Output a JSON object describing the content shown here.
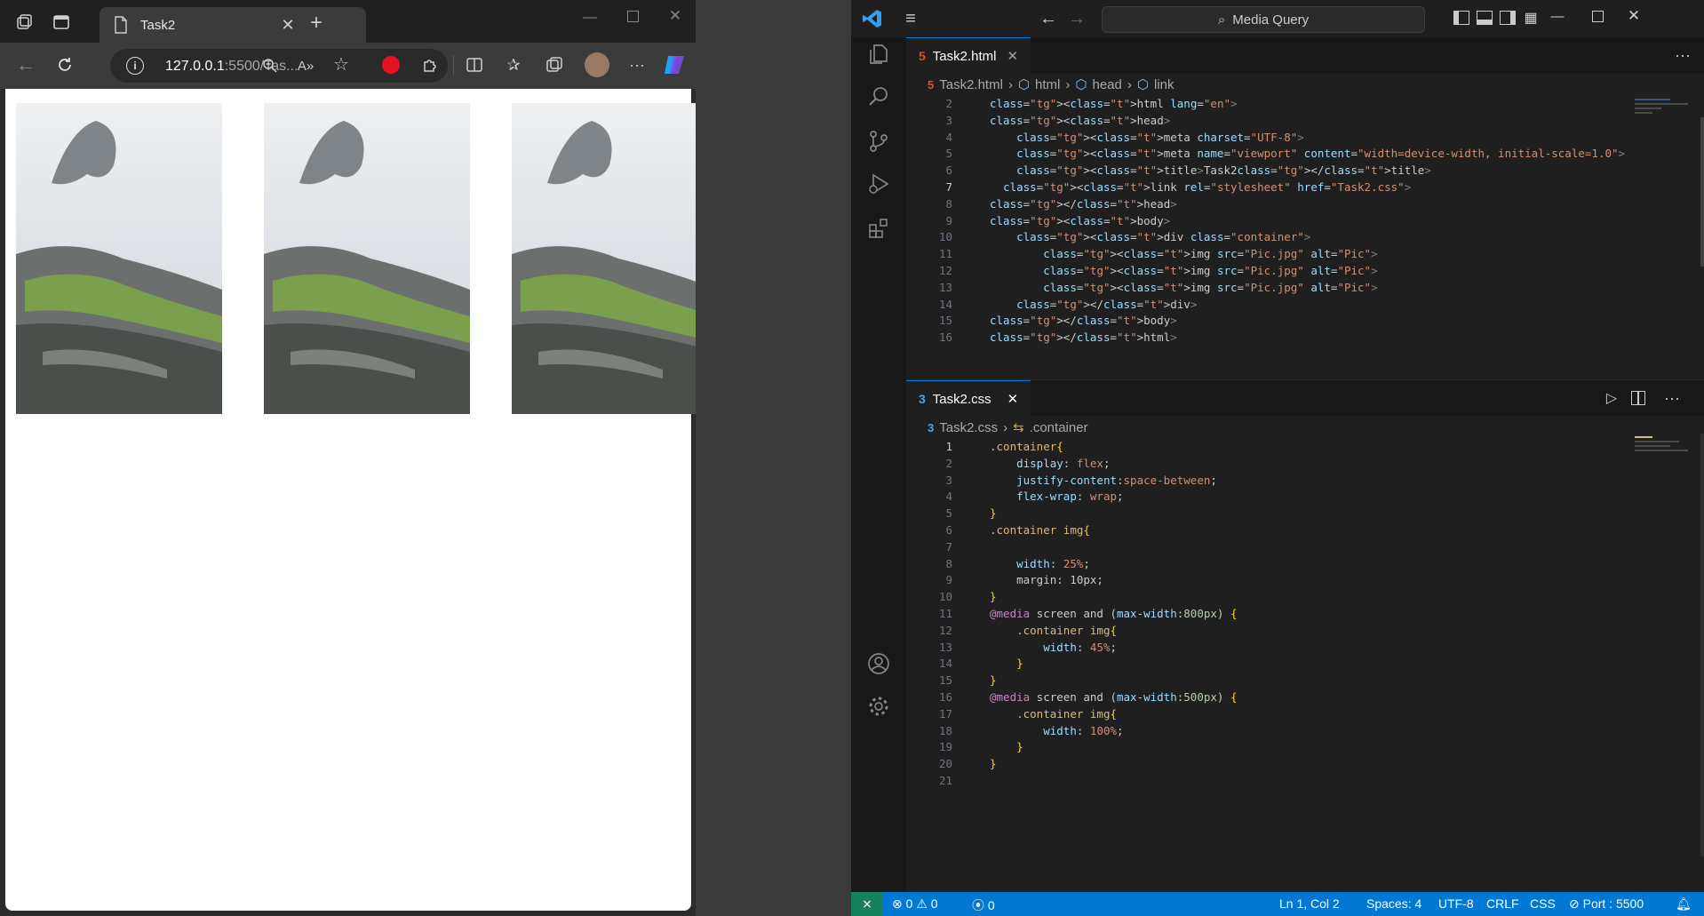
{
  "browser": {
    "tab_title": "Task2",
    "url_host": "127.0.0.1",
    "url_rest": ":5500/Tas...",
    "images": [
      {
        "alt": "Pic"
      },
      {
        "alt": "Pic"
      },
      {
        "alt": "Pic"
      }
    ]
  },
  "vscode": {
    "command_center": "Media Query",
    "top_editor": {
      "tab_label": "Task2.html",
      "breadcrumb": [
        "Task2.html",
        "html",
        "head",
        "link"
      ],
      "line_numbers": [
        "2",
        "3",
        "4",
        "5",
        "6",
        "7",
        "8",
        "9",
        "10",
        "11",
        "12",
        "13",
        "14",
        "15",
        "16"
      ],
      "lines": [
        "<html lang=\"en\">",
        "<head>",
        "    <meta charset=\"UTF-8\">",
        "    <meta name=\"viewport\" content=\"width=device-width, initial-scale=1.0\">",
        "    <title>Task2</title>",
        "  <link rel=\"stylesheet\" href=\"Task2.css\">",
        "</head>",
        "<body>",
        "    <div class=\"container\">",
        "        <img src=\"Pic.jpg\" alt=\"Pic\">",
        "        <img src=\"Pic.jpg\" alt=\"Pic\">",
        "        <img src=\"Pic.jpg\" alt=\"Pic\">",
        "    </div>",
        "</body>",
        "</html>"
      ]
    },
    "bottom_editor": {
      "tab_label": "Task2.css",
      "breadcrumb": [
        "Task2.css",
        ".container"
      ],
      "line_numbers": [
        "1",
        "2",
        "3",
        "4",
        "5",
        "6",
        "7",
        "8",
        "9",
        "10",
        "11",
        "12",
        "13",
        "14",
        "15",
        "16",
        "17",
        "18",
        "19",
        "20",
        "21"
      ],
      "lines": [
        ".container{",
        "    display: flex;",
        "    justify-content:space-between;",
        "    flex-wrap: wrap;",
        "}",
        ".container img{",
        "",
        "    width: 25%;",
        "    margin: 10px;",
        "}",
        "@media screen and (max-width:800px) {",
        "    .container img{",
        "        width: 45%;",
        "    }",
        "}",
        "@media screen and (max-width:500px) {",
        "    .container img{",
        "        width: 100%;",
        "    }",
        "}",
        ""
      ]
    },
    "status": {
      "errors": "0",
      "warnings": "0",
      "ports": "0",
      "position": "Ln 1, Col 2",
      "spaces": "Spaces: 4",
      "encoding": "UTF-8",
      "eol": "CRLF",
      "language": "CSS",
      "port": "Port : 5500"
    },
    "accent_color": "#0078d4"
  }
}
